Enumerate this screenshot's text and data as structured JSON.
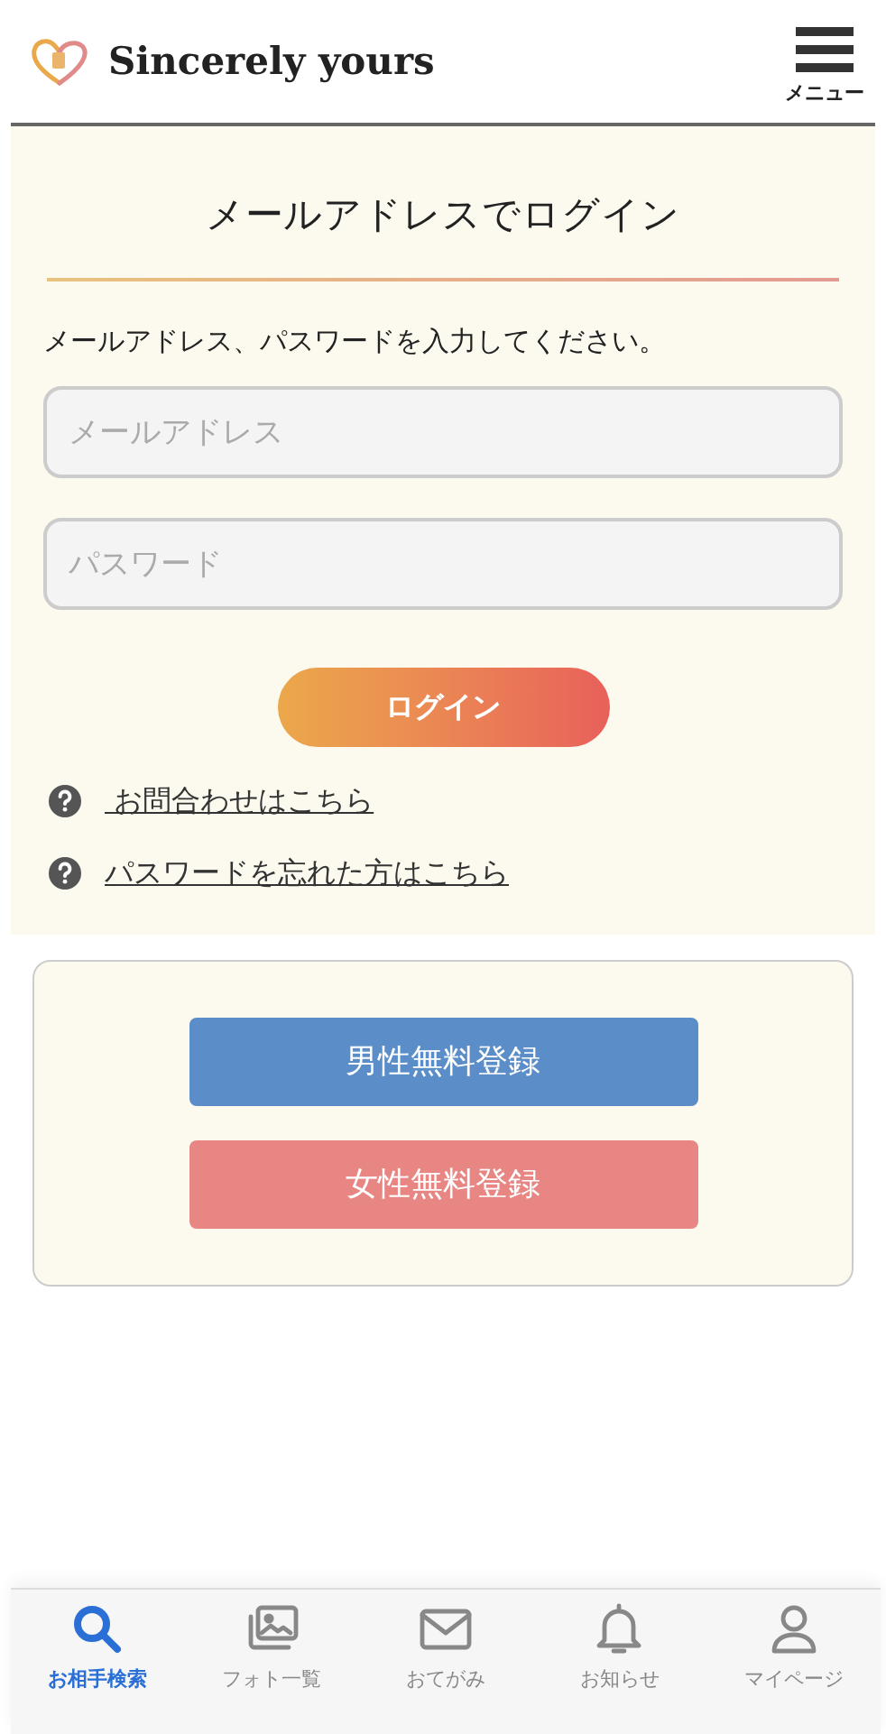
{
  "header": {
    "brand": "Sincerely yours",
    "menu_label": "メニュー"
  },
  "login": {
    "title": "メールアドレスでログイン",
    "instruction": "メールアドレス、パスワードを入力してください。",
    "email": {
      "placeholder": "メールアドレス"
    },
    "password": {
      "placeholder": "パスワード"
    },
    "button": "ログイン",
    "links": [
      " お問合わせはこちら",
      "パスワードを忘れた方はこちら"
    ]
  },
  "register": [
    {
      "label": "男性無料登録",
      "color": "#5b8ec8"
    },
    {
      "label": "女性無料登録",
      "color": "#e88684"
    }
  ],
  "nav": [
    {
      "kind": "search",
      "label": "お相手検索",
      "selected": true
    },
    {
      "kind": "photos",
      "label": "フォト一覧",
      "selected": false
    },
    {
      "kind": "mail",
      "label": "おてがみ",
      "selected": false
    },
    {
      "kind": "bell",
      "label": "お知らせ",
      "selected": false
    },
    {
      "kind": "user",
      "label": "マイページ",
      "selected": false
    }
  ]
}
